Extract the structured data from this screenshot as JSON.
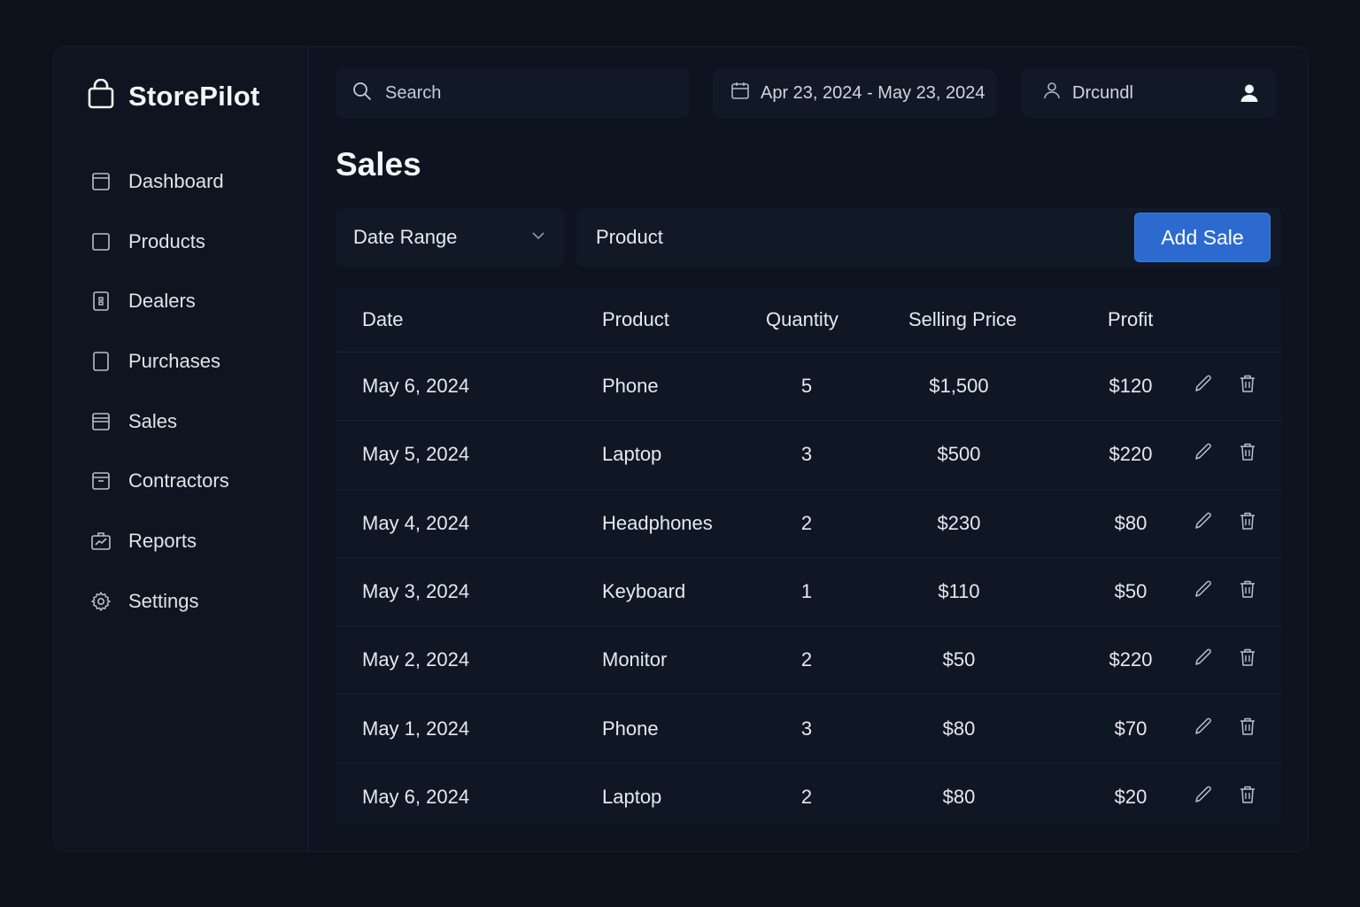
{
  "brand": {
    "name": "StorePilot"
  },
  "sidebar": {
    "items": [
      {
        "label": "Dashboard",
        "icon": "dashboard-icon"
      },
      {
        "label": "Products",
        "icon": "products-icon"
      },
      {
        "label": "Dealers",
        "icon": "dealers-icon"
      },
      {
        "label": "Purchases",
        "icon": "purchases-icon"
      },
      {
        "label": "Sales",
        "icon": "sales-icon"
      },
      {
        "label": "Contractors",
        "icon": "contractors-icon"
      },
      {
        "label": "Reports",
        "icon": "reports-icon"
      },
      {
        "label": "Settings",
        "icon": "gear-icon"
      }
    ]
  },
  "topbar": {
    "search_placeholder": "Search",
    "date_range": "Apr 23, 2024 - May 23, 2024",
    "username": "Drcundl"
  },
  "page": {
    "title": "Sales"
  },
  "filters": {
    "date_range_label": "Date Range",
    "product_placeholder": "Product",
    "add_button": "Add Sale"
  },
  "table": {
    "columns": [
      "Date",
      "Product",
      "Quantity",
      "Selling Price",
      "Profit"
    ],
    "rows": [
      {
        "date": "May 6, 2024",
        "product": "Phone",
        "quantity": "5",
        "price": "$1,500",
        "profit": "$120"
      },
      {
        "date": "May 5, 2024",
        "product": "Laptop",
        "quantity": "3",
        "price": "$500",
        "profit": "$220"
      },
      {
        "date": "May 4, 2024",
        "product": "Headphones",
        "quantity": "2",
        "price": "$230",
        "profit": "$80"
      },
      {
        "date": "May 3, 2024",
        "product": "Keyboard",
        "quantity": "1",
        "price": "$110",
        "profit": "$50"
      },
      {
        "date": "May 2, 2024",
        "product": "Monitor",
        "quantity": "2",
        "price": "$50",
        "profit": "$220"
      },
      {
        "date": "May 1, 2024",
        "product": "Phone",
        "quantity": "3",
        "price": "$80",
        "profit": "$70"
      },
      {
        "date": "May 6, 2024",
        "product": "Laptop",
        "quantity": "2",
        "price": "$80",
        "profit": "$20"
      }
    ]
  },
  "colors": {
    "background": "#0c111b",
    "panel": "#0e141f",
    "accent": "#2d6ad0",
    "text": "#e4e9ef"
  }
}
